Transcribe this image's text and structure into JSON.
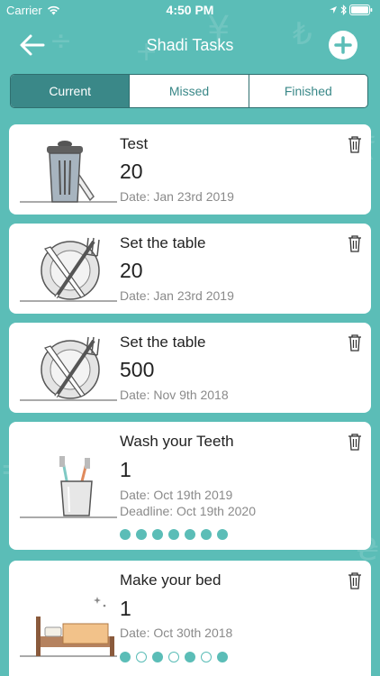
{
  "status_bar": {
    "carrier": "Carrier",
    "time": "4:50 PM"
  },
  "nav": {
    "title": "Shadi Tasks"
  },
  "tabs": [
    {
      "label": "Current",
      "active": true
    },
    {
      "label": "Missed",
      "active": false
    },
    {
      "label": "Finished",
      "active": false
    }
  ],
  "tasks": [
    {
      "title": "Test",
      "value": "20",
      "date": "Date: Jan 23rd 2019",
      "icon": "trash-can-illustration"
    },
    {
      "title": "Set the table",
      "value": "20",
      "date": "Date: Jan 23rd 2019",
      "icon": "plate-fork-knife-illustration"
    },
    {
      "title": "Set the table",
      "value": "500",
      "date": "Date: Nov 9th 2018",
      "icon": "plate-fork-knife-illustration"
    },
    {
      "title": "Wash your Teeth",
      "value": "1",
      "date": "Date: Oct 19th 2019",
      "deadline": "Deadline: Oct 19th 2020",
      "icon": "toothbrush-cup-illustration",
      "progress": [
        true,
        true,
        true,
        true,
        true,
        true,
        true
      ]
    },
    {
      "title": "Make your bed",
      "value": "1",
      "date": "Date: Oct 30th 2018",
      "icon": "bed-illustration",
      "progress": [
        true,
        false,
        true,
        false,
        true,
        false,
        true
      ]
    }
  ],
  "colors": {
    "background": "#5bbdb7",
    "accent": "#3a8888",
    "card": "#ffffff",
    "muted_text": "#8a8a8a"
  }
}
